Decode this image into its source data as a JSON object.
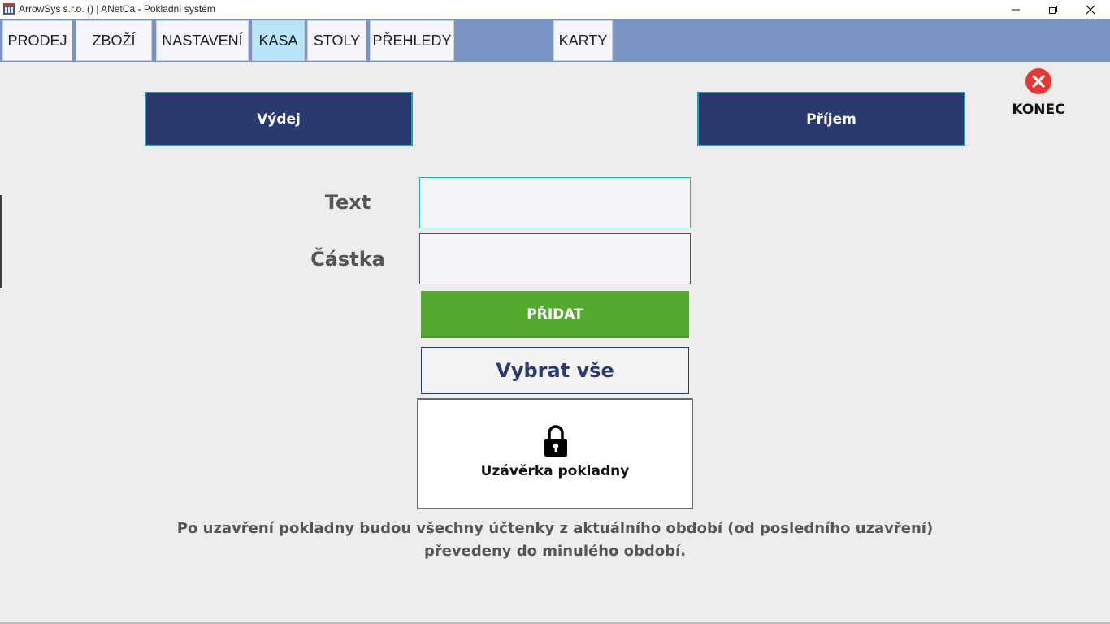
{
  "window": {
    "title": "ArrowSys s.r.o. () | ANetCa - Pokladní systém",
    "minimize_icon": "minimize-icon",
    "maximize_icon": "restore-icon",
    "close_icon": "close-icon"
  },
  "tabs": [
    {
      "label": "PRODEJ",
      "active": false
    },
    {
      "label": "ZBOŽÍ",
      "active": false
    },
    {
      "label": "NASTAVENÍ",
      "active": false
    },
    {
      "label": "KASA",
      "active": true
    },
    {
      "label": "STOLY",
      "active": false
    },
    {
      "label": "PŘEHLEDY",
      "active": false
    },
    {
      "label": "KARTY",
      "active": false
    }
  ],
  "actions": {
    "vydej_label": "Výdej",
    "prijem_label": "Příjem",
    "konec_label": "KONEC"
  },
  "form": {
    "text_label": "Text",
    "text_value": "",
    "castka_label": "Částka",
    "castka_value": "",
    "pridat_label": "PŘIDAT",
    "vybrat_label": "Vybrat vše"
  },
  "closing": {
    "button_label": "Uzávěrka pokladny",
    "icon": "lock-icon",
    "note": "Po uzavření pokladny budou všechny účtenky z aktuálního období (od posledního uzavření) převedeny do minulého období."
  },
  "colors": {
    "tabbar": "#7994c3",
    "active_tab": "#b8e6f7",
    "primary": "#2b3a6e",
    "accent_border": "#1f9cc7",
    "add_green": "#56a92f",
    "konec_red": "#e53935"
  }
}
